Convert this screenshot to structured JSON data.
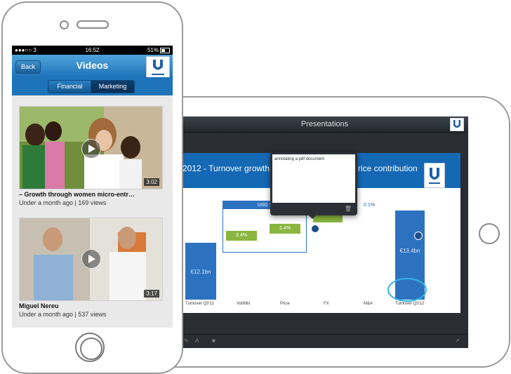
{
  "phone": {
    "status": {
      "carrier": "●●●○○ 3",
      "time": "16:52",
      "right": "51%",
      "battery_level": 0.51
    },
    "nav": {
      "back_label": "Back",
      "title": "Videos",
      "logo_text": "Unilever"
    },
    "segments": [
      "Financial",
      "Marketing"
    ],
    "segment_selected": "Marketing",
    "videos": [
      {
        "title": "– Growth through women micro-entr…",
        "meta": "Under a month ago | 169 views",
        "duration": "3:02"
      },
      {
        "title": "Miguel Nereu",
        "meta": "Under a month ago | 537 views",
        "duration": "3:17"
      }
    ]
  },
  "ipad": {
    "title": "Presentations",
    "slide": {
      "title_left": "2012 - Turnover growth 1",
      "title_right": "rice contribution",
      "usg_label": "USG 5",
      "values": [
        "3.4%",
        "2.4%",
        "0.1%"
      ],
      "bars": [
        "€12.1bn",
        "€13.4bn"
      ],
      "x_labels": [
        "Turnover Q3'11",
        "Vol/Mix",
        "Price",
        "FX",
        "M&A",
        "Turnover Q3'12"
      ]
    },
    "annotation_text": "annotating a pdf document"
  },
  "colors": {
    "brand_blue": "#1f73b8",
    "bar_blue": "#2d72c0",
    "green": "#8ab640",
    "highlight": "#2fb4e6"
  }
}
